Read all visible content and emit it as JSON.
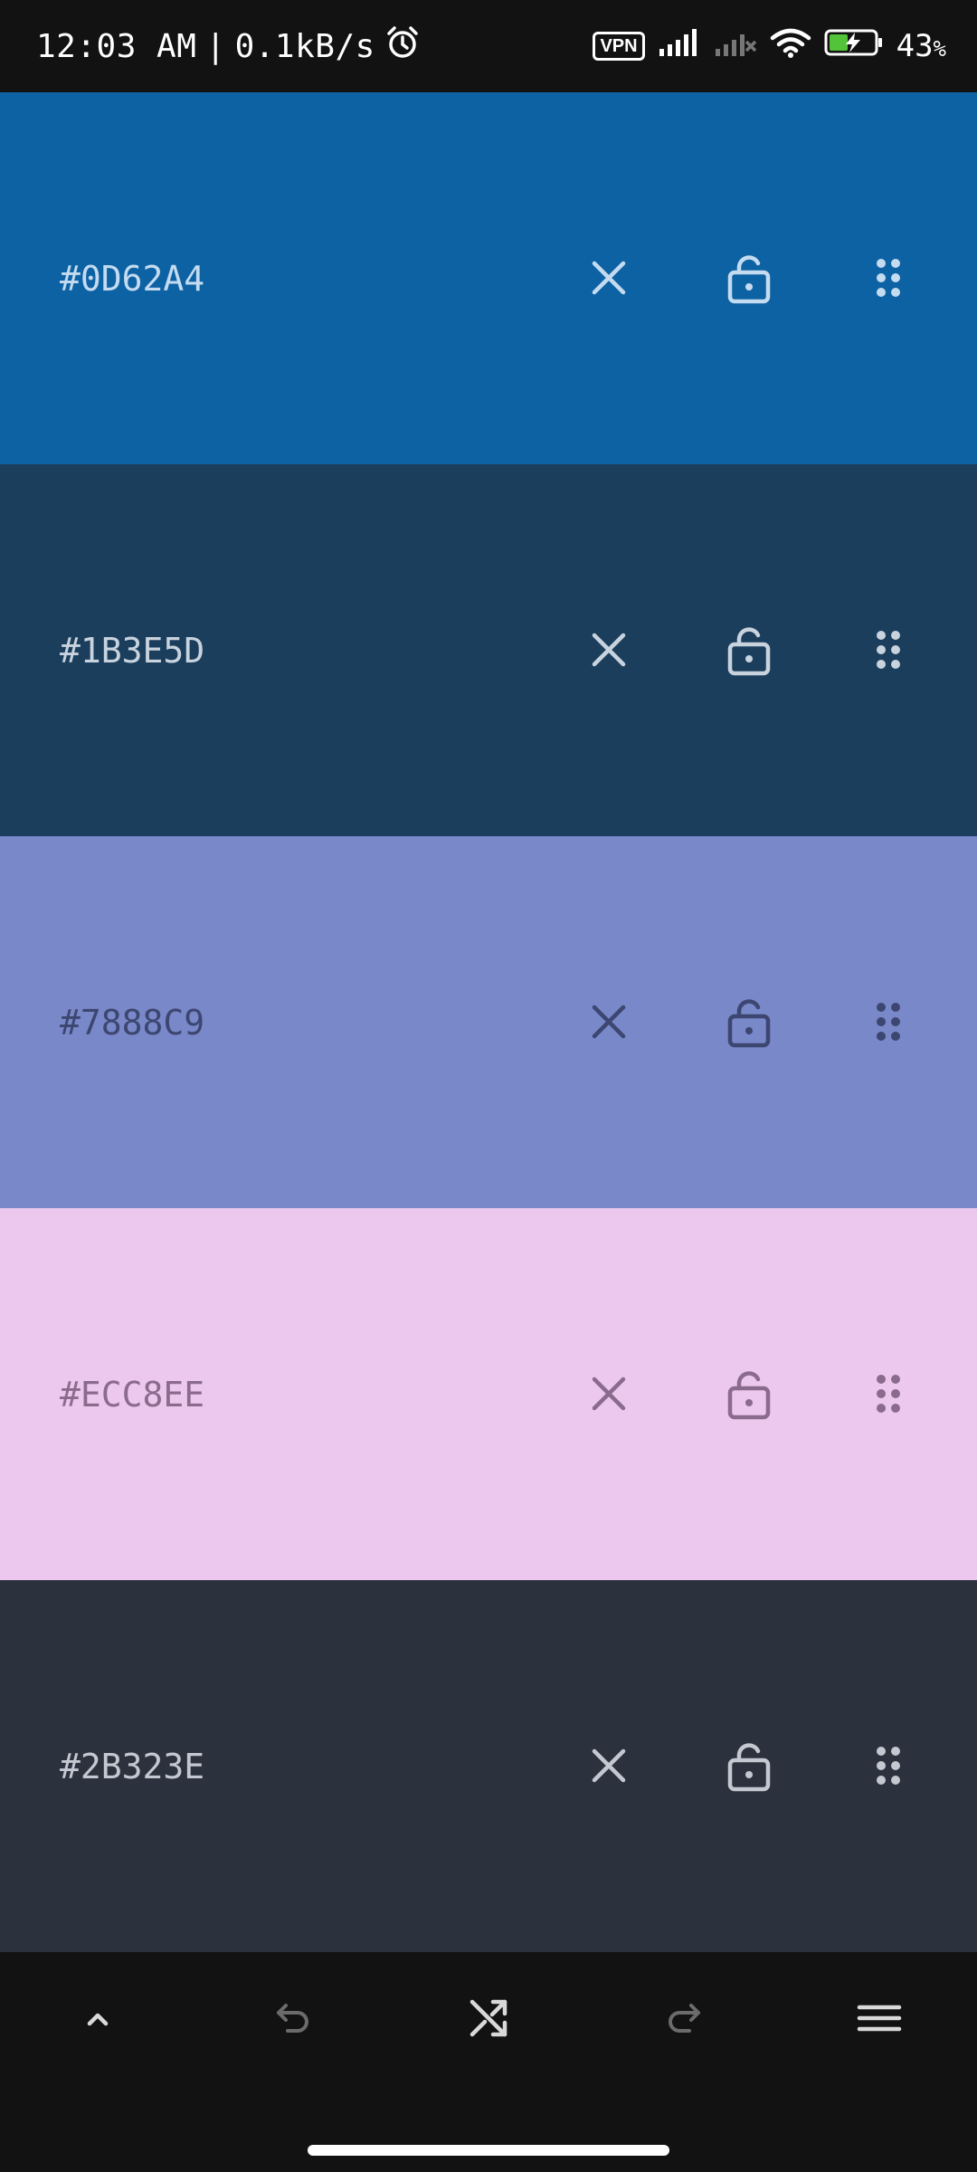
{
  "status": {
    "time": "12:03 AM",
    "separator": "|",
    "speed": "0.1kB/s",
    "vpn": "VPN",
    "battery": "43",
    "battery_unit": "%"
  },
  "swatches": [
    {
      "hex": "#0D62A4",
      "bg": "#0D62A4",
      "fg": "#C4DBF0",
      "icons": [
        "close-icon",
        "unlocked-lock-icon",
        "drag-handle-icon"
      ]
    },
    {
      "hex": "#1B3E5D",
      "bg": "#1B3E5D",
      "fg": "#C9D3DE",
      "icons": [
        "close-icon",
        "unlocked-lock-icon",
        "drag-handle-icon"
      ]
    },
    {
      "hex": "#7888C9",
      "bg": "#7888C9",
      "fg": "#3D4670",
      "icons": [
        "close-icon",
        "unlocked-lock-icon",
        "drag-handle-icon"
      ]
    },
    {
      "hex": "#ECC8EE",
      "bg": "#ECC8EE",
      "fg": "#8A6B8E",
      "icons": [
        "close-icon",
        "unlocked-lock-icon",
        "drag-handle-icon"
      ]
    },
    {
      "hex": "#2B323E",
      "bg": "#2B323E",
      "fg": "#C4C8D0",
      "icons": [
        "close-icon",
        "unlocked-lock-icon",
        "drag-handle-icon"
      ]
    }
  ],
  "bottom_nav": {
    "items": [
      "expand-up-icon",
      "undo-icon",
      "shuffle-icon",
      "redo-icon",
      "menu-icon"
    ],
    "active_color": "#D9D9D9",
    "disabled_color": "#6B6B6B"
  }
}
